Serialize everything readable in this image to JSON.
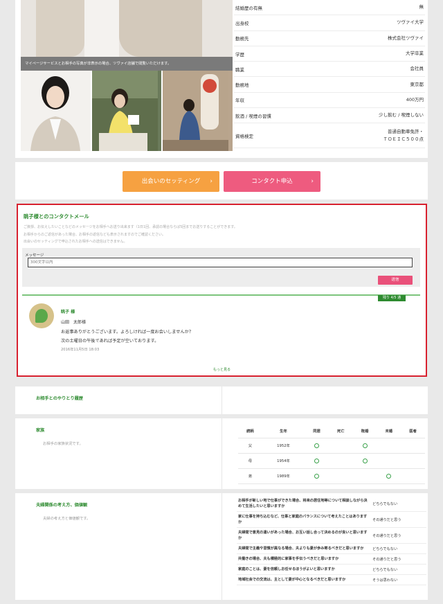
{
  "photos": {
    "caption": "マイページサービスとお相手の写真が非表示の場合、ツヴァイ店舗で閲覧いただけます。"
  },
  "profile": [
    {
      "label": "結婚歴の有無",
      "value": "無"
    },
    {
      "label": "出身校",
      "value": "ツヴァイ大学"
    },
    {
      "label": "勤務先",
      "value": "株式会社ツヴァイ"
    },
    {
      "label": "学歴",
      "value": "大学卒業"
    },
    {
      "label": "職業",
      "value": "会社員"
    },
    {
      "label": "勤務地",
      "value": "東京都"
    },
    {
      "label": "年収",
      "value": "400万円"
    },
    {
      "label": "飲酒 / 喫煙の習慣",
      "value": "少し飲む / 喫煙しない"
    },
    {
      "label": "資格検定",
      "value": "普通自動車免許・",
      "value2": "ＴＯＥＩＣ５００点"
    }
  ],
  "buttons": {
    "setting": "出会いのセッティング",
    "contact": "コンタクト申込",
    "chevron": "›"
  },
  "mail": {
    "title": "眺子様とのコンタクトメール",
    "desc1": "ご挨拶、お伝えしたいことなどのメッセージをお相手へお送り出来ます（1日1回、承認の場合ならば5回までお送りすることができます。",
    "desc2": "お相手からのご返信があった場合、お相手の返信なども表示されますのでご確認ください。",
    "desc3": "出会いのセッティングで申込されたお相手への送信はできません。",
    "message_label": "メッセージ",
    "input_placeholder": "300文字以内",
    "send_label": "送信",
    "remaining": "残り 4/5 通",
    "item": {
      "name": "眺子 様",
      "sender": "山田　太郎様",
      "line1": "お返事ありがとうございます。よろしければ一度お会いしませんか？",
      "line2": "次の土曜日の午後であれば予定が空いております。",
      "date": "2016年11月5日 18:03"
    },
    "more": "もっと見る"
  },
  "history": {
    "title": "お相手とのやりとり履歴"
  },
  "family": {
    "title": "家族",
    "sub": "お相手の家族状況です。",
    "headers": [
      "続柄",
      "生年",
      "同居",
      "死亡",
      "既婚",
      "未婚",
      "医者"
    ],
    "rows": [
      {
        "rel": "父",
        "year": "1952年",
        "marks": [
          true,
          false,
          true,
          false,
          false
        ]
      },
      {
        "rel": "母",
        "year": "1954年",
        "marks": [
          true,
          false,
          true,
          false,
          false
        ]
      },
      {
        "rel": "弟",
        "year": "1989年",
        "marks": [
          true,
          false,
          false,
          true,
          false
        ]
      }
    ]
  },
  "values": {
    "title": "夫婦関係の考え方、価値観",
    "sub": "夫婦の考え方と価値観です。",
    "rows": [
      {
        "q": "お相手が新しい地で仕事ができた場合、将来の居住地等について相談しながら決めて生活したいと思いますか",
        "a": "どちらでもない"
      },
      {
        "q": "家に仕事を持ち込むなど、仕事と家庭のバランスについて考えたことはありますか",
        "a": "その通りだと思う"
      },
      {
        "q": "夫婦間で意見の違いがあった場合、お互い話し合って決めるのが良いと思いますか",
        "a": "その通りだと思う"
      },
      {
        "q": "夫婦間で主義や習慣が異なる場合、夫よりも妻が歩み寄るべきだと思いますか",
        "a": "どちらでもない"
      },
      {
        "q": "共働きの場合、夫も積極的に家事を手伝うべきだと思いますか",
        "a": "その通りだと思う"
      },
      {
        "q": "家庭のことは、妻を信頼しお任せるほうがよいと思いますか",
        "a": "どちらでもない"
      },
      {
        "q": "地域社会での交流は、主として妻が中心となるべきだと思いますか",
        "a": "そうは思わない"
      }
    ]
  }
}
